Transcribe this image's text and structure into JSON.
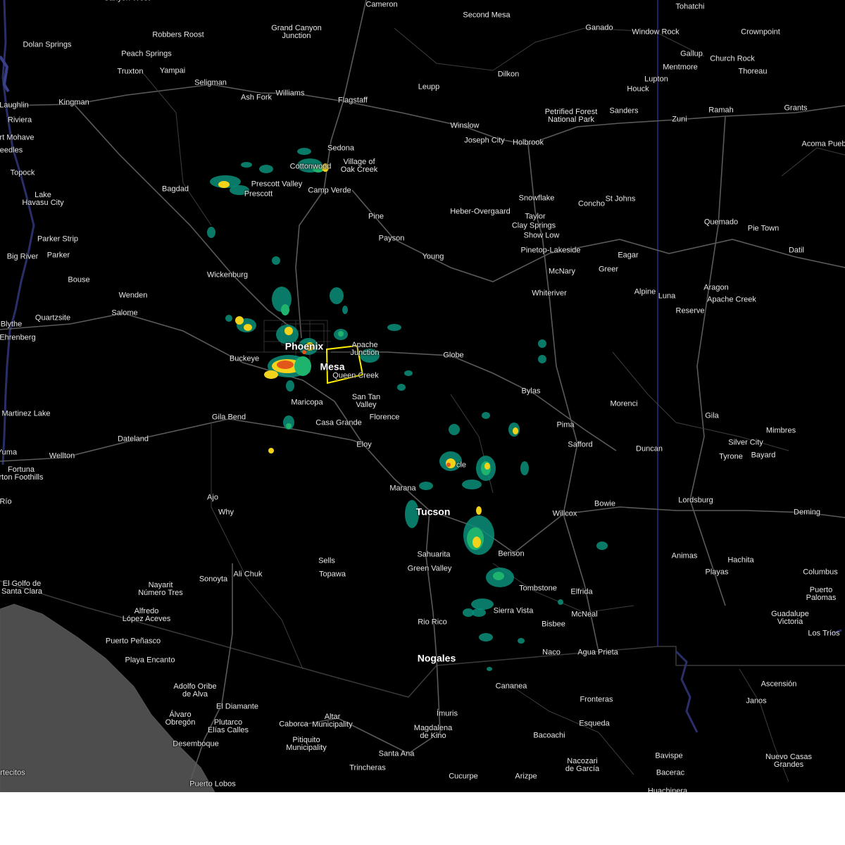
{
  "map": {
    "warning_color": "#ffee00",
    "radar_colors": {
      "light": "#0a8f7a",
      "moderate": "#1fb46e",
      "heavy": "#f2d21a",
      "intense": "#e2561a"
    },
    "places": [
      {
        "id": "canyon-west",
        "name": "Canyon West"
      },
      {
        "id": "cameron",
        "name": "Cameron"
      },
      {
        "id": "tohatchi",
        "name": "Tohatchi"
      },
      {
        "id": "second-mesa",
        "name": "Second Mesa"
      },
      {
        "id": "robbers-roost",
        "name": "Robbers Roost"
      },
      {
        "id": "grand-canyon-junction",
        "name": "Grand Canyon\nJunction"
      },
      {
        "id": "ganado",
        "name": "Ganado"
      },
      {
        "id": "window-rock",
        "name": "Window Rock"
      },
      {
        "id": "crownpoint",
        "name": "Crownpoint"
      },
      {
        "id": "dolan-springs",
        "name": "Dolan Springs"
      },
      {
        "id": "peach-springs",
        "name": "Peach Springs"
      },
      {
        "id": "gallup",
        "name": "Gallup"
      },
      {
        "id": "church-rock",
        "name": "Church Rock"
      },
      {
        "id": "mentmore",
        "name": "Mentmore"
      },
      {
        "id": "truxton",
        "name": "Truxton"
      },
      {
        "id": "yampai",
        "name": "Yampai"
      },
      {
        "id": "dilkon",
        "name": "Dilkon"
      },
      {
        "id": "thoreau",
        "name": "Thoreau"
      },
      {
        "id": "seligman",
        "name": "Seligman"
      },
      {
        "id": "lupton",
        "name": "Lupton"
      },
      {
        "id": "leupp",
        "name": "Leupp"
      },
      {
        "id": "houck",
        "name": "Houck"
      },
      {
        "id": "ash-fork",
        "name": "Ash Fork"
      },
      {
        "id": "williams",
        "name": "Williams"
      },
      {
        "id": "flagstaff",
        "name": "Flagstaff"
      },
      {
        "id": "laughlin",
        "name": "Laughlin"
      },
      {
        "id": "kingman",
        "name": "Kingman"
      },
      {
        "id": "grants",
        "name": "Grants"
      },
      {
        "id": "ramah",
        "name": "Ramah"
      },
      {
        "id": "petrified-forest",
        "name": "Petrified Forest\nNational Park"
      },
      {
        "id": "sanders",
        "name": "Sanders"
      },
      {
        "id": "zuni",
        "name": "Zuni"
      },
      {
        "id": "riviera",
        "name": "Riviera"
      },
      {
        "id": "winslow",
        "name": "Winslow"
      },
      {
        "id": "fort-mohave",
        "name": "rt Mohave"
      },
      {
        "id": "joseph-city",
        "name": "Joseph City"
      },
      {
        "id": "holbrook",
        "name": "Holbrook"
      },
      {
        "id": "acoma-pueblo",
        "name": "Acoma Pueb"
      },
      {
        "id": "sedona",
        "name": "Sedona"
      },
      {
        "id": "needles",
        "name": "eedles"
      },
      {
        "id": "village-of-oak-creek",
        "name": "Village of\nOak Creek"
      },
      {
        "id": "cottonwood",
        "name": "Cottonwood"
      },
      {
        "id": "topock",
        "name": "Topock"
      },
      {
        "id": "prescott-valley",
        "name": "Prescott Valley"
      },
      {
        "id": "bagdad",
        "name": "Bagdad"
      },
      {
        "id": "camp-verde",
        "name": "Camp Verde"
      },
      {
        "id": "prescott",
        "name": "Prescott"
      },
      {
        "id": "lake-havasu-city",
        "name": "Lake\nHavasu City"
      },
      {
        "id": "snowflake",
        "name": "Snowflake"
      },
      {
        "id": "st-johns",
        "name": "St Johns"
      },
      {
        "id": "concho",
        "name": "Concho"
      },
      {
        "id": "heber-overgaard",
        "name": "Heber-Overgaard"
      },
      {
        "id": "pine",
        "name": "Pine"
      },
      {
        "id": "taylor",
        "name": "Taylor"
      },
      {
        "id": "quemado",
        "name": "Quemado"
      },
      {
        "id": "clay-springs",
        "name": "Clay Springs"
      },
      {
        "id": "pie-town",
        "name": "Pie Town"
      },
      {
        "id": "show-low",
        "name": "Show Low"
      },
      {
        "id": "parker-strip",
        "name": "Parker Strip"
      },
      {
        "id": "payson",
        "name": "Payson"
      },
      {
        "id": "pinetop-lakeside",
        "name": "Pinetop-Lakeside"
      },
      {
        "id": "eagar",
        "name": "Eagar"
      },
      {
        "id": "datil",
        "name": "Datil"
      },
      {
        "id": "big-river",
        "name": "Big River"
      },
      {
        "id": "parker",
        "name": "Parker"
      },
      {
        "id": "young",
        "name": "Young"
      },
      {
        "id": "greer",
        "name": "Greer"
      },
      {
        "id": "mcnary",
        "name": "McNary"
      },
      {
        "id": "wickenburg",
        "name": "Wickenburg"
      },
      {
        "id": "bouse",
        "name": "Bouse"
      },
      {
        "id": "aragon",
        "name": "Aragon"
      },
      {
        "id": "alpine",
        "name": "Alpine"
      },
      {
        "id": "luna",
        "name": "Luna"
      },
      {
        "id": "whiteriver",
        "name": "Whiteriver"
      },
      {
        "id": "wenden",
        "name": "Wenden"
      },
      {
        "id": "apache-creek",
        "name": "Apache Creek"
      },
      {
        "id": "reserve",
        "name": "Reserve"
      },
      {
        "id": "salome",
        "name": "Salome"
      },
      {
        "id": "quartzsite",
        "name": "Quartzsite"
      },
      {
        "id": "blythe",
        "name": "Blythe"
      },
      {
        "id": "ehrenberg",
        "name": "Ehrenberg"
      },
      {
        "id": "phoenix",
        "name": "Phoenix"
      },
      {
        "id": "apache-junction",
        "name": "Apache\nJunction"
      },
      {
        "id": "buckeye",
        "name": "Buckeye"
      },
      {
        "id": "globe",
        "name": "Globe"
      },
      {
        "id": "mesa",
        "name": "Mesa"
      },
      {
        "id": "queen-creek",
        "name": "Queen Creek"
      },
      {
        "id": "bylas",
        "name": "Bylas"
      },
      {
        "id": "san-tan-valley",
        "name": "San Tan\nValley"
      },
      {
        "id": "maricopa",
        "name": "Maricopa"
      },
      {
        "id": "morenci",
        "name": "Morenci"
      },
      {
        "id": "martinez-lake",
        "name": "Martinez Lake"
      },
      {
        "id": "gila",
        "name": "Gila"
      },
      {
        "id": "gila-bend",
        "name": "Gila Bend"
      },
      {
        "id": "florence",
        "name": "Florence"
      },
      {
        "id": "casa-grande",
        "name": "Casa Grande"
      },
      {
        "id": "pima",
        "name": "Pima"
      },
      {
        "id": "mimbres",
        "name": "Mimbres"
      },
      {
        "id": "dateland",
        "name": "Dateland"
      },
      {
        "id": "safford",
        "name": "Safford"
      },
      {
        "id": "silver-city",
        "name": "Silver City"
      },
      {
        "id": "eloy",
        "name": "Eloy"
      },
      {
        "id": "duncan",
        "name": "Duncan"
      },
      {
        "id": "yuma",
        "name": "Yuma"
      },
      {
        "id": "tyrone",
        "name": "Tyrone"
      },
      {
        "id": "bayard",
        "name": "Bayard"
      },
      {
        "id": "wellton",
        "name": "Wellton"
      },
      {
        "id": "oracle",
        "name": "cle"
      },
      {
        "id": "fortuna-foothills",
        "name": "Fortuna\nrton Foothills"
      },
      {
        "id": "marana",
        "name": "Marana"
      },
      {
        "id": "ajo",
        "name": "Ajo"
      },
      {
        "id": "rio",
        "name": "Río"
      },
      {
        "id": "lordsburg",
        "name": "Lordsburg"
      },
      {
        "id": "bowie",
        "name": "Bowie"
      },
      {
        "id": "tucson",
        "name": "Tucson"
      },
      {
        "id": "why",
        "name": "Why"
      },
      {
        "id": "willcox",
        "name": "Willcox"
      },
      {
        "id": "deming",
        "name": "Deming"
      },
      {
        "id": "benson",
        "name": "Benson"
      },
      {
        "id": "sahuarita",
        "name": "Sahuarita"
      },
      {
        "id": "animas",
        "name": "Animas"
      },
      {
        "id": "hachita",
        "name": "Hachita"
      },
      {
        "id": "sells",
        "name": "Sells"
      },
      {
        "id": "green-valley",
        "name": "Green Valley"
      },
      {
        "id": "playas",
        "name": "Playas"
      },
      {
        "id": "columbus",
        "name": "Columbus"
      },
      {
        "id": "ali-chuk",
        "name": "Ali Chuk"
      },
      {
        "id": "topawa",
        "name": "Topawa"
      },
      {
        "id": "sonoyta",
        "name": "Sonoyta"
      },
      {
        "id": "el-golfo",
        "name": "El Golfo de\nSanta Clara"
      },
      {
        "id": "tombstone",
        "name": "Tombstone"
      },
      {
        "id": "elfrida",
        "name": "Elfrida"
      },
      {
        "id": "nayarit",
        "name": "Nayarit\nNúmero Tres"
      },
      {
        "id": "puerto-palomas",
        "name": "Puerto\nPalomas"
      },
      {
        "id": "sierra-vista",
        "name": "Sierra Vista"
      },
      {
        "id": "mcneal",
        "name": "McNeal"
      },
      {
        "id": "alfredo",
        "name": "Alfredo\nLópez Aceves"
      },
      {
        "id": "guadalupe-victoria",
        "name": "Guadalupe\nVictoria"
      },
      {
        "id": "rio-rico",
        "name": "Rio Rico"
      },
      {
        "id": "bisbee",
        "name": "Bisbee"
      },
      {
        "id": "los-trios",
        "name": "Los Tríos"
      },
      {
        "id": "puerto-penasco",
        "name": "Puerto Peñasco"
      },
      {
        "id": "playa-encanto",
        "name": "Playa Encanto"
      },
      {
        "id": "naco",
        "name": "Naco"
      },
      {
        "id": "agua-prieta",
        "name": "Agua Prieta"
      },
      {
        "id": "nogales",
        "name": "Nogales"
      },
      {
        "id": "cananea",
        "name": "Cananea"
      },
      {
        "id": "ascension",
        "name": "Ascensión"
      },
      {
        "id": "adolfo-oribe",
        "name": "Adolfo Oribe\nde Alva"
      },
      {
        "id": "fronteras",
        "name": "Fronteras"
      },
      {
        "id": "janos",
        "name": "Janos"
      },
      {
        "id": "el-diamante",
        "name": "El Diamante"
      },
      {
        "id": "imuris",
        "name": "Ímuris"
      },
      {
        "id": "alvaro-obregon",
        "name": "Álvaro\nObregón"
      },
      {
        "id": "plutarco",
        "name": "Plutarco\nElías Calles"
      },
      {
        "id": "caborca",
        "name": "Caborca"
      },
      {
        "id": "altar",
        "name": "Altar\nMunicipality"
      },
      {
        "id": "esqueda",
        "name": "Esqueda"
      },
      {
        "id": "magdalena",
        "name": "Magdalena\nde Kino"
      },
      {
        "id": "bacoachi",
        "name": "Bacoachi"
      },
      {
        "id": "pitiquito",
        "name": "Pitiquito\nMunicipality"
      },
      {
        "id": "desemboque",
        "name": "Desemboque"
      },
      {
        "id": "santa-ana",
        "name": "Santa Ana"
      },
      {
        "id": "bavispe",
        "name": "Bavispe"
      },
      {
        "id": "nuevo-casas-grandes",
        "name": "Nuevo Casas\nGrandes"
      },
      {
        "id": "nacozari",
        "name": "Nacozari\nde García"
      },
      {
        "id": "trincheras",
        "name": "Trincheras"
      },
      {
        "id": "bacerac",
        "name": "Bacerac"
      },
      {
        "id": "cucurpe",
        "name": "Cucurpe"
      },
      {
        "id": "arizpe",
        "name": "Arizpe"
      },
      {
        "id": "puerto-lobos",
        "name": "Puerto Lobos"
      },
      {
        "id": "certicos",
        "name": "rtecitos"
      },
      {
        "id": "huachinera",
        "name": "Huachinera"
      }
    ]
  }
}
